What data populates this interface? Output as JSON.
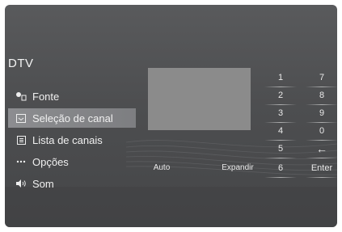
{
  "header": {
    "title": "DTV"
  },
  "menu": {
    "items": [
      {
        "label": "Fonte",
        "icon": "source-icon"
      },
      {
        "label": "Seleção de canal",
        "icon": "channel-select-icon",
        "selected": true
      },
      {
        "label": "Lista de canais",
        "icon": "list-icon"
      },
      {
        "label": "Opções",
        "icon": "dots-icon"
      },
      {
        "label": "Som",
        "icon": "speaker-icon"
      }
    ]
  },
  "keypad": {
    "col1": [
      "1",
      "2",
      "3",
      "4",
      "5",
      "6"
    ],
    "col2": [
      "7",
      "8",
      "9",
      "0",
      "←",
      "Enter"
    ]
  },
  "controls": {
    "auto": "Auto",
    "expand": "Expandir"
  },
  "colors": {
    "background": "#4d4e50",
    "selected": "#8c8d90",
    "preview": "#8b8b8b",
    "text": "#f0f0f0"
  }
}
